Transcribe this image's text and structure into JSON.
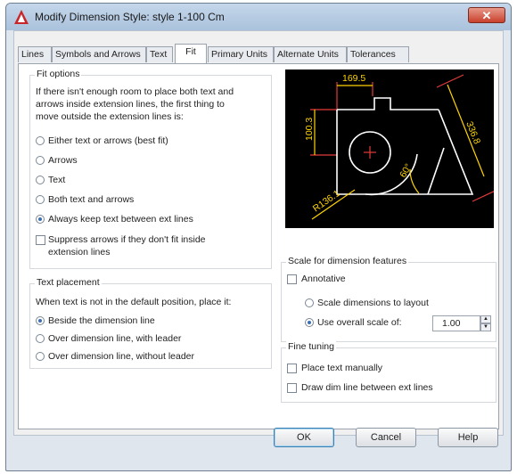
{
  "window": {
    "title": "Modify Dimension Style: style 1-100 Cm",
    "close": "✕"
  },
  "tabs": [
    {
      "label": "Lines"
    },
    {
      "label": "Symbols and Arrows"
    },
    {
      "label": "Text"
    },
    {
      "label": "Fit"
    },
    {
      "label": "Primary Units"
    },
    {
      "label": "Alternate Units"
    },
    {
      "label": "Tolerances"
    }
  ],
  "active_tab": "Fit",
  "fit_options": {
    "title": "Fit options",
    "description": [
      "If there isn't enough room to place both text and",
      "arrows inside extension lines, the first thing to",
      "move outside the extension lines is:"
    ],
    "radios": [
      {
        "label": "Either text or arrows (best fit)",
        "selected": false
      },
      {
        "label": "Arrows",
        "selected": false
      },
      {
        "label": "Text",
        "selected": false
      },
      {
        "label": "Both text and arrows",
        "selected": false
      },
      {
        "label": "Always keep text between ext lines",
        "selected": true
      }
    ],
    "suppress_checkbox": {
      "label_line1": "Suppress arrows if they don't fit inside",
      "label_line2": "extension lines",
      "checked": false
    }
  },
  "text_placement": {
    "title": "Text placement",
    "description": "When text is not in the default position, place it:",
    "radios": [
      {
        "label": "Beside the dimension line",
        "selected": true
      },
      {
        "label": "Over dimension line, with leader",
        "selected": false
      },
      {
        "label": "Over dimension line, without leader",
        "selected": false
      }
    ]
  },
  "preview": {
    "labels": [
      "169.5",
      "100.3",
      "336.8",
      "60°",
      "R136.1"
    ],
    "colors": {
      "bg": "#000000",
      "lines": "#ffffff",
      "dims": "#ffd400",
      "ext": "#e23b3b"
    }
  },
  "scale": {
    "title": "Scale for dimension features",
    "annotative": {
      "label": "Annotative",
      "checked": false
    },
    "radio_layout": {
      "label": "Scale dimensions to layout",
      "selected": false
    },
    "radio_overall": {
      "label": "Use overall scale of:",
      "selected": true
    },
    "overall_value": "1.00"
  },
  "fine_tuning": {
    "title": "Fine tuning",
    "place_text": {
      "label": "Place text manually",
      "checked": false
    },
    "draw_dim": {
      "label": "Draw dim line between ext lines",
      "checked": false
    }
  },
  "buttons": {
    "ok": "OK",
    "cancel": "Cancel",
    "help": "Help"
  }
}
